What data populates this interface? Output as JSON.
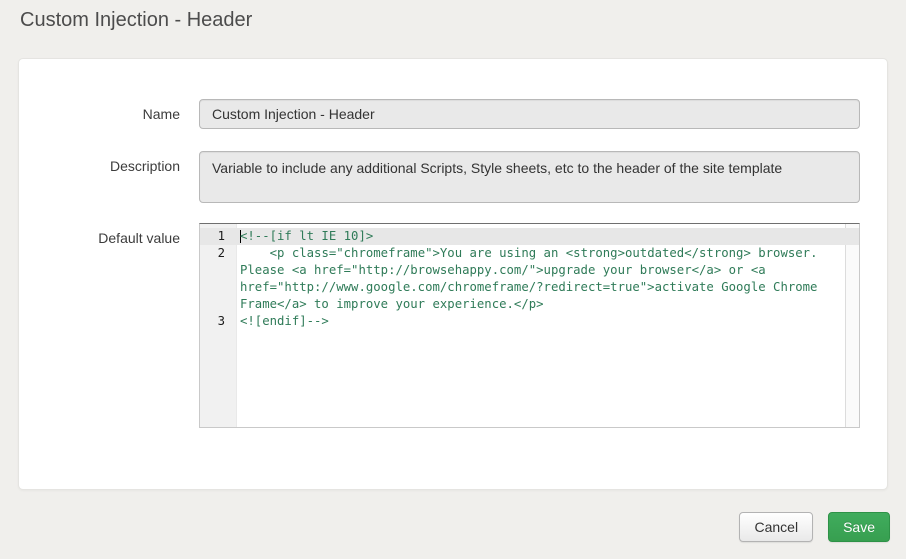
{
  "page": {
    "title": "Custom Injection - Header"
  },
  "form": {
    "name": {
      "label": "Name",
      "value": "Custom Injection - Header"
    },
    "description": {
      "label": "Description",
      "value": "Variable to include any additional Scripts, Style sheets, etc to the header of the site template"
    },
    "default_value": {
      "label": "Default value",
      "editor": {
        "lines": [
          {
            "number": "1",
            "code": "<!--[if lt IE 10]>",
            "active": true
          },
          {
            "number": "2",
            "code": "    <p class=\"chromeframe\">You are using an <strong>outdated</strong> browser. Please <a href=\"http://browsehappy.com/\">upgrade your browser</a> or <a href=\"http://www.google.com/chromeframe/?redirect=true\">activate Google Chrome Frame</a> to improve your experience.</p>",
            "active": false
          },
          {
            "number": "3",
            "code": "<![endif]-->",
            "active": false
          }
        ]
      }
    }
  },
  "actions": {
    "cancel_label": "Cancel",
    "save_label": "Save"
  },
  "colors": {
    "page_background": "#f0efec",
    "accent_green": "#3aa558",
    "code_text": "#2f7b58",
    "disabled_field_background": "#e9e9e9",
    "active_line_background": "#e7e7e7"
  }
}
